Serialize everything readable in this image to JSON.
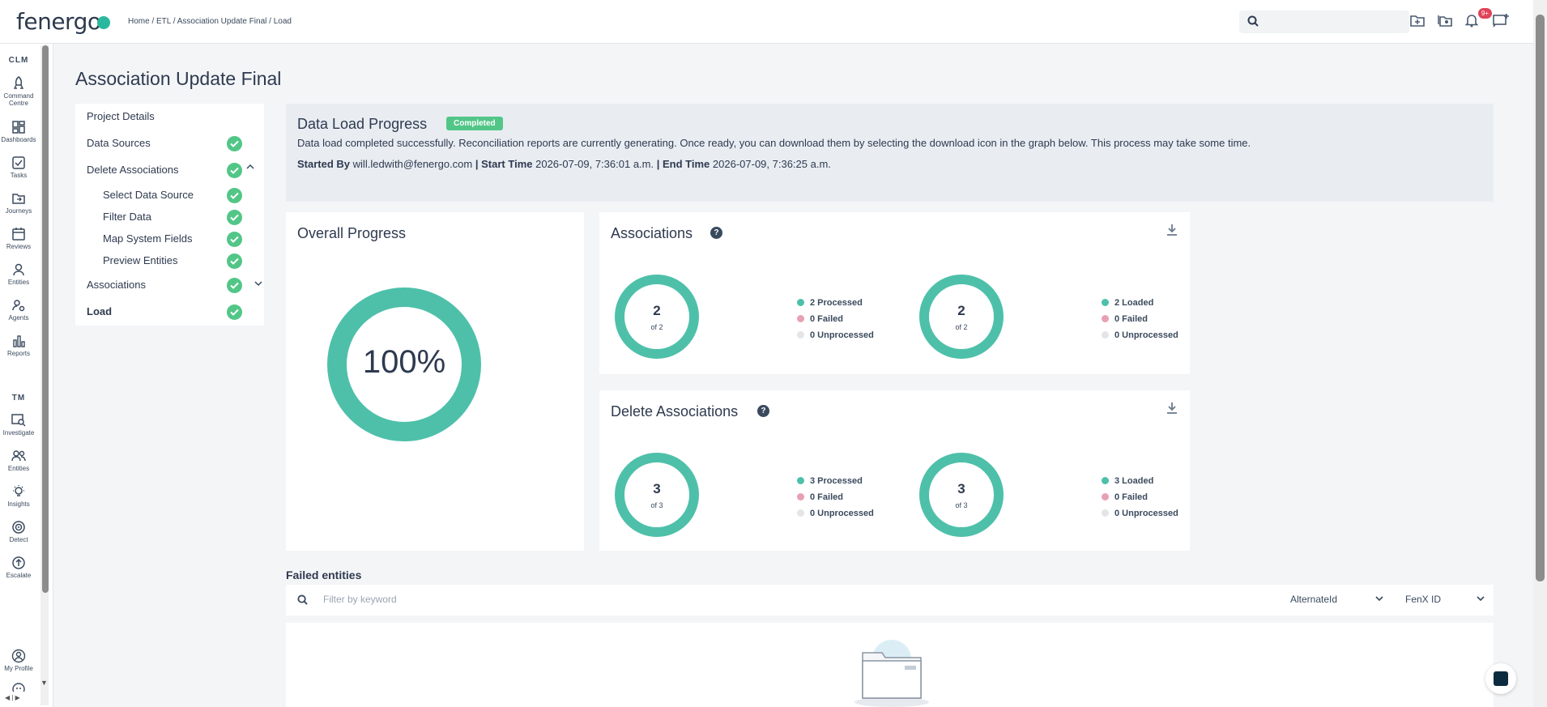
{
  "header": {
    "logo": "fenergo",
    "breadcrumb": "Home / ETL / Association Update Final / Load",
    "notifications_badge": "9+"
  },
  "sidebar": {
    "clm_label": "CLM",
    "tm_label": "TM",
    "items": [
      {
        "label": "Command Centre",
        "icon": "rocket-icon"
      },
      {
        "label": "Dashboards",
        "icon": "dashboard-icon"
      },
      {
        "label": "Tasks",
        "icon": "tasks-icon"
      },
      {
        "label": "Journeys",
        "icon": "journeys-icon"
      },
      {
        "label": "Reviews",
        "icon": "calendar-icon"
      },
      {
        "label": "Entities",
        "icon": "person-icon"
      },
      {
        "label": "Agents",
        "icon": "agents-icon"
      },
      {
        "label": "Reports",
        "icon": "bar-chart-icon"
      }
    ],
    "tm_items": [
      {
        "label": "Investigate",
        "icon": "investigate-icon"
      },
      {
        "label": "Entities",
        "icon": "people-icon"
      },
      {
        "label": "Insights",
        "icon": "lightbulb-icon"
      },
      {
        "label": "Detect",
        "icon": "target-icon"
      },
      {
        "label": "Escalate",
        "icon": "escalate-icon"
      }
    ],
    "profile_label": "My Profile"
  },
  "page": {
    "title": "Association Update Final"
  },
  "steps": {
    "project_details": "Project Details",
    "data_sources": "Data Sources",
    "delete_associations": "Delete Associations",
    "select_data_source": "Select Data Source",
    "filter_data": "Filter Data",
    "map_system_fields": "Map System Fields",
    "preview_entities": "Preview Entities",
    "associations": "Associations",
    "load": "Load"
  },
  "progress": {
    "title": "Data Load Progress",
    "status": "Completed",
    "message": "Data load completed successfully. Reconciliation reports are currently generating. Once ready, you can download them by selecting the download icon in the graph below. This process may take some time.",
    "started_by_label": "Started By",
    "started_by": "will.ledwith@fenergo.com",
    "start_time_label": "Start Time",
    "start_time": "2026-07-09, 7:36:01 a.m.",
    "end_time_label": "End Time",
    "end_time": "2026-07-09, 7:36:25 a.m.",
    "separator": "|"
  },
  "overall": {
    "title": "Overall Progress",
    "percent_label": "100%",
    "percent": 100
  },
  "associations_card": {
    "title": "Associations",
    "processed": {
      "value": "2",
      "of": "of 2",
      "legend": [
        "2 Processed",
        "0 Failed",
        "0 Unprocessed"
      ]
    },
    "loaded": {
      "value": "2",
      "of": "of 2",
      "legend": [
        "2 Loaded",
        "0 Failed",
        "0 Unprocessed"
      ]
    }
  },
  "delete_card": {
    "title": "Delete Associations",
    "processed": {
      "value": "3",
      "of": "of 3",
      "legend": [
        "3 Processed",
        "0 Failed",
        "0 Unprocessed"
      ]
    },
    "loaded": {
      "value": "3",
      "of": "of 3",
      "legend": [
        "3 Loaded",
        "0 Failed",
        "0 Unprocessed"
      ]
    }
  },
  "failed": {
    "title": "Failed entities",
    "filter_placeholder": "Filter by keyword",
    "select1": "AlternateId",
    "select2": "FenX ID"
  },
  "colors": {
    "teal": "#4ec0aa",
    "failed": "#e8a0b4",
    "unprocessed": "#e3e5e8",
    "success": "#52c687"
  }
}
